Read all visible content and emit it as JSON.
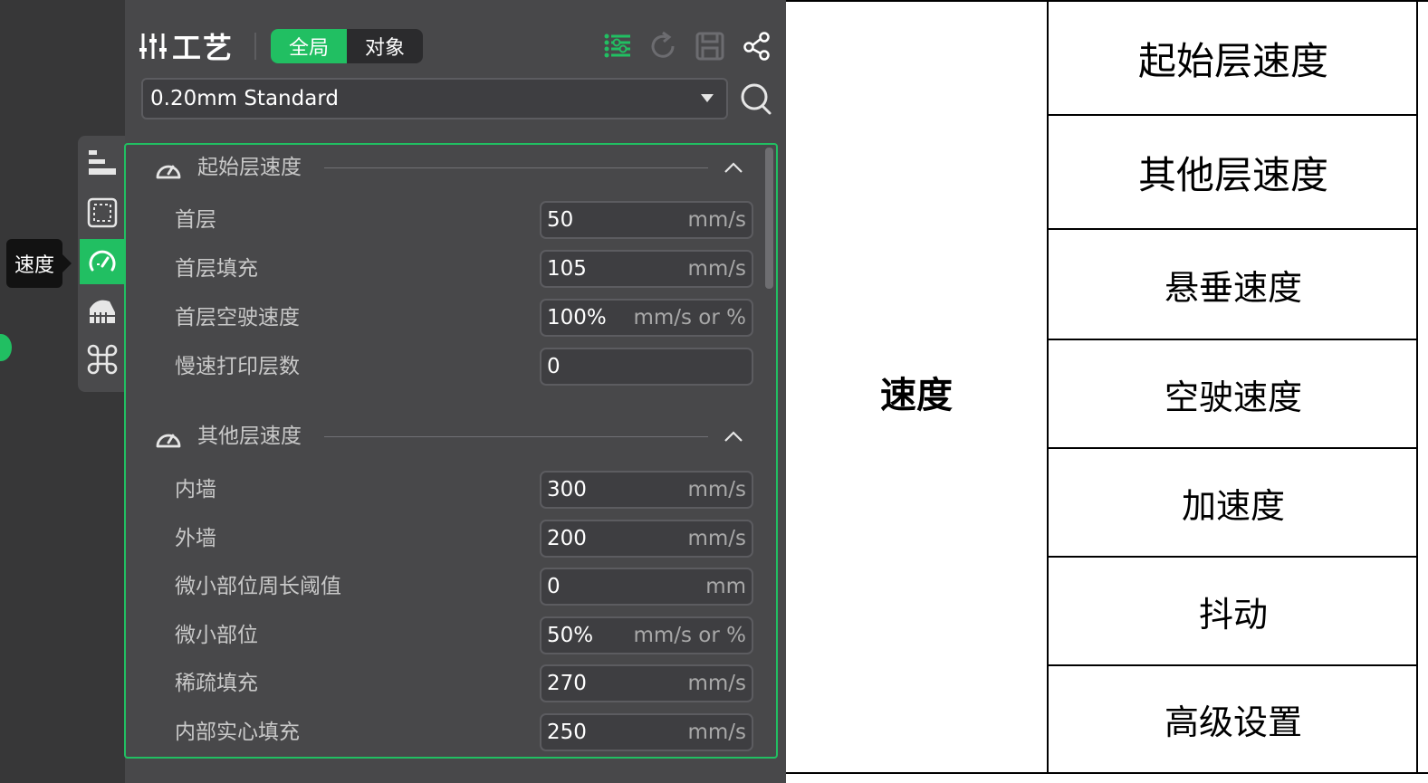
{
  "tooltip": "速度",
  "header": {
    "title": "工艺",
    "scope_global": "全局",
    "scope_object": "对象"
  },
  "preset": {
    "value": "0.20mm Standard"
  },
  "sections": [
    {
      "title": "起始层速度",
      "rows": [
        {
          "label": "首层",
          "value": "50",
          "unit": "mm/s"
        },
        {
          "label": "首层填充",
          "value": "105",
          "unit": "mm/s"
        },
        {
          "label": "首层空驶速度",
          "value": "100%",
          "unit": "mm/s or %"
        },
        {
          "label": "慢速打印层数",
          "value": "0",
          "unit": ""
        }
      ]
    },
    {
      "title": "其他层速度",
      "rows": [
        {
          "label": "内墙",
          "value": "300",
          "unit": "mm/s"
        },
        {
          "label": "外墙",
          "value": "200",
          "unit": "mm/s"
        },
        {
          "label": "微小部位周长阈值",
          "value": "0",
          "unit": "mm"
        },
        {
          "label": "微小部位",
          "value": "50%",
          "unit": "mm/s or %"
        },
        {
          "label": "稀疏填充",
          "value": "270",
          "unit": "mm/s"
        },
        {
          "label": "内部实心填充",
          "value": "250",
          "unit": "mm/s"
        }
      ]
    }
  ],
  "table": {
    "category": "速度",
    "items": [
      "起始层速度",
      "其他层速度",
      "悬垂速度",
      "空驶速度",
      "加速度",
      "抖动",
      "高级设置"
    ]
  },
  "colors": {
    "accent": "#21bf62",
    "panel_bg": "#48484a",
    "sidebar_bg": "#373738"
  }
}
